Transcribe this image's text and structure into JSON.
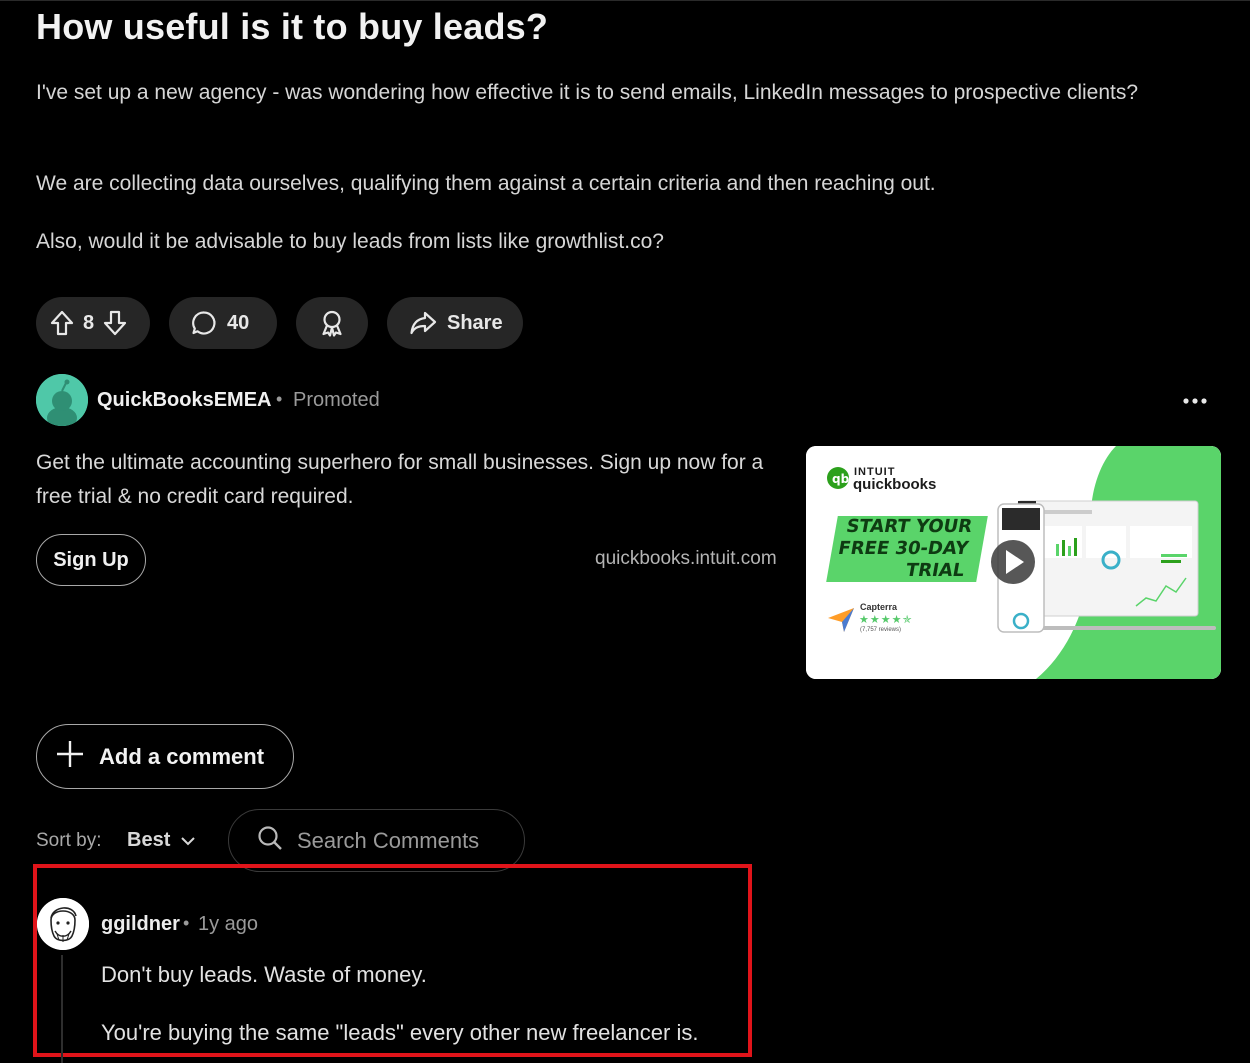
{
  "post": {
    "title": "How useful is it to buy leads?",
    "paragraphs": [
      "I've set up a new agency - was wondering how effective it is to send emails, LinkedIn messages to prospective clients?",
      "We are collecting data ourselves, qualifying them against a certain criteria and then reaching out.",
      "Also, would it be advisable to buy leads from lists like growthlist.co?"
    ],
    "actions": {
      "vote_count": "8",
      "comment_count": "40",
      "share_label": "Share"
    }
  },
  "ad": {
    "author": "QuickBooksEMEA",
    "separator": "•",
    "promoted_label": "Promoted",
    "text": "Get the ultimate accounting superhero for small businesses. Sign up now for a free trial & no credit card required.",
    "cta_label": "Sign Up",
    "domain": "quickbooks.intuit.com",
    "image": {
      "brand_top": "INTUIT",
      "brand_main": "quickbooks",
      "banner_lines": [
        "START YOUR",
        "FREE 30-DAY",
        "TRIAL"
      ],
      "rating_source": "Capterra",
      "rating_stars": "★★★★✯",
      "rating_reviews": "(7,757 reviews)",
      "accent_color": "#5ad46a"
    }
  },
  "comments_section": {
    "add_comment_label": "Add a comment",
    "sort_label": "Sort by:",
    "sort_value": "Best",
    "search_placeholder": "Search Comments"
  },
  "comment": {
    "author": "ggildner",
    "separator": "•",
    "time": "1y ago",
    "lines": [
      "Don't buy leads. Waste of money.",
      "You're buying the same \"leads\" every other new freelancer is."
    ],
    "highlight_color": "#e0141a"
  }
}
